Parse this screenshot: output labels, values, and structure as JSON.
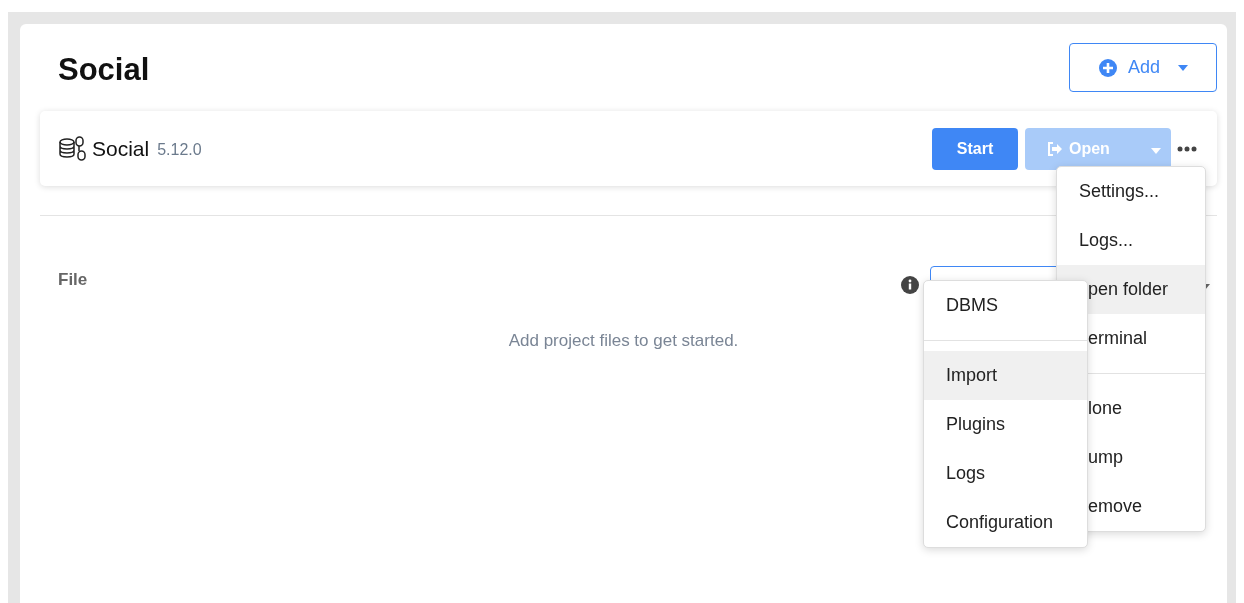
{
  "page": {
    "title": "Social",
    "add_button": {
      "label": "Add"
    }
  },
  "project": {
    "name": "Social",
    "version": "5.12.0",
    "start_button": "Start",
    "open_button": {
      "label": "Open",
      "disabled": true
    }
  },
  "file_section": {
    "label": "File",
    "empty_message": "Add project files to get started."
  },
  "more_menu": {
    "items": [
      {
        "label": "Settings...",
        "hovered": false
      },
      {
        "label": "Logs...",
        "hovered": false
      },
      {
        "label": "pen folder",
        "hovered": true
      },
      {
        "label": "erminal",
        "hovered": false
      },
      {
        "kind": "divider"
      },
      {
        "label": "lone",
        "hovered": false
      },
      {
        "label": "ump",
        "hovered": false
      },
      {
        "label": "emove",
        "hovered": false
      }
    ]
  },
  "add_menu": {
    "items": [
      {
        "label": "DBMS",
        "hovered": false
      },
      {
        "kind": "divider"
      },
      {
        "label": "Import",
        "hovered": true
      },
      {
        "label": "Plugins",
        "hovered": false
      },
      {
        "label": "Logs",
        "hovered": false
      },
      {
        "label": "Configuration",
        "hovered": false
      }
    ]
  }
}
